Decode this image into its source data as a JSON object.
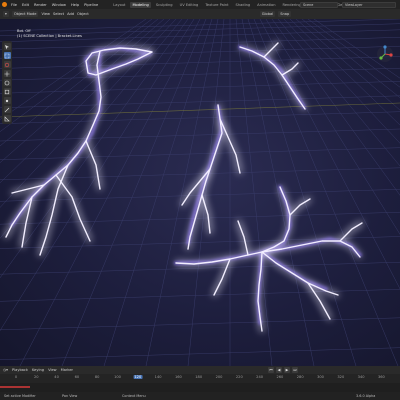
{
  "menus": [
    "File",
    "Edit",
    "Render",
    "Window",
    "Help",
    "Pipeline"
  ],
  "workspace_tabs": [
    "Layout",
    "Modeling",
    "Sculpting",
    "UV Editing",
    "Texture Paint",
    "Shading",
    "Animation",
    "Rendering",
    "Compositing",
    "Geometry Nodes",
    "Scripting"
  ],
  "active_workspace": "Modeling",
  "scene": "Scene",
  "view_layer": "ViewLayer",
  "header": {
    "mode": "Object Mode",
    "view": "View",
    "select": "Select",
    "add": "Add",
    "object": "Object",
    "transform_orientation": "Global",
    "snap": "Snap",
    "select_box": "Select Box"
  },
  "viewport": {
    "line1": "Bot. Off",
    "line2": "(1) SCENE Collection | Bracket.Lines"
  },
  "timeline": {
    "menus": [
      "Playback",
      "Keying",
      "View",
      "Marker"
    ],
    "ticks": [
      0,
      20,
      40,
      60,
      80,
      100,
      120,
      140,
      160,
      180,
      200,
      220,
      240,
      260,
      280,
      300,
      320,
      340,
      360
    ],
    "current_frame": 120
  },
  "status": {
    "item1": "Set active Modifier",
    "item2": "Pan View",
    "item3": "Context Menu",
    "version": "3.6.0 Alpha"
  },
  "colors": {
    "accent": "#4772b3",
    "bolt_glow": "#7b5cff",
    "bolt_core": "#f2eeff",
    "logo": "#e87d0d"
  }
}
